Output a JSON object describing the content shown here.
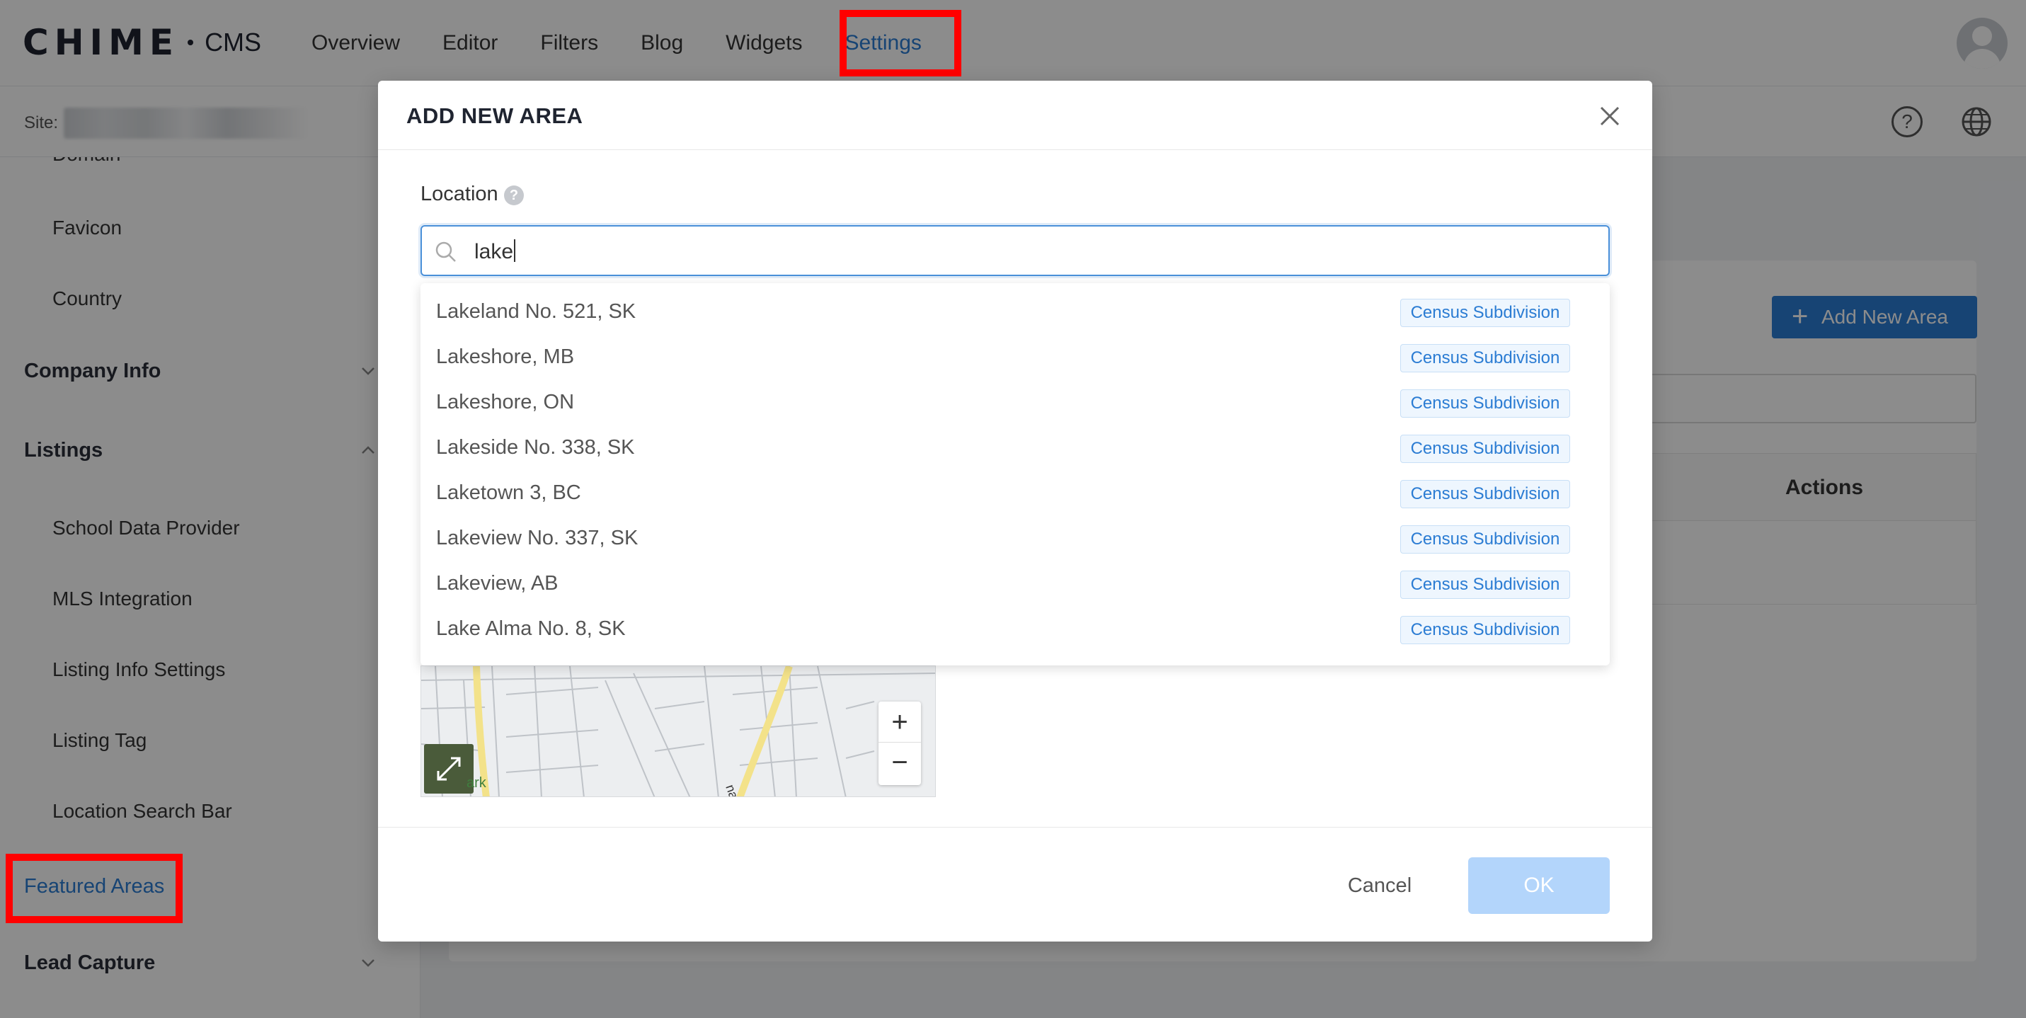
{
  "topnav": {
    "logo_text": "CHIME",
    "logo_suffix": "CMS",
    "items": [
      {
        "label": "Overview"
      },
      {
        "label": "Editor"
      },
      {
        "label": "Filters"
      },
      {
        "label": "Blog"
      },
      {
        "label": "Widgets"
      },
      {
        "label": "Settings",
        "active": true
      }
    ]
  },
  "subbar": {
    "site_label": "Site:"
  },
  "sidebar": {
    "items_top": [
      "Domain",
      "Favicon",
      "Country"
    ],
    "groups": {
      "company_info": "Company Info",
      "listings": "Listings",
      "lead_capture": "Lead Capture"
    },
    "listings_items": [
      "School Data Provider",
      "MLS Integration",
      "Listing Info Settings",
      "Listing Tag",
      "Location Search Bar"
    ],
    "featured_areas": "Featured Areas"
  },
  "background": {
    "add_new_area": "Add New Area",
    "actions_header": "Actions"
  },
  "modal": {
    "title": "ADD NEW AREA",
    "location_label": "Location",
    "help_glyph": "?",
    "search_value": "lake",
    "results": [
      {
        "name": "Lakeland No. 521, SK",
        "tag": "Census Subdivision"
      },
      {
        "name": "Lakeshore, MB",
        "tag": "Census Subdivision"
      },
      {
        "name": "Lakeshore, ON",
        "tag": "Census Subdivision"
      },
      {
        "name": "Lakeside No. 338, SK",
        "tag": "Census Subdivision"
      },
      {
        "name": "Laketown 3, BC",
        "tag": "Census Subdivision"
      },
      {
        "name": "Lakeview No. 337, SK",
        "tag": "Census Subdivision"
      },
      {
        "name": "Lakeview, AB",
        "tag": "Census Subdivision"
      },
      {
        "name": "Lake Alma No. 8, SK",
        "tag": "Census Subdivision"
      }
    ],
    "map": {
      "zoom_in": "+",
      "zoom_out": "−",
      "street_label": "na Ave.",
      "park_label": "ark"
    },
    "cancel_label": "Cancel",
    "ok_label": "OK"
  },
  "colors": {
    "accent": "#2b7cd3",
    "highlight": "#ff0000",
    "ok_disabled": "#b3d5fb"
  },
  "icons": [
    "user-avatar-icon",
    "help-circle-icon",
    "globe-icon",
    "chevron-down-icon",
    "chevron-up-icon",
    "plus-icon",
    "close-icon",
    "search-icon",
    "expand-icon"
  ]
}
